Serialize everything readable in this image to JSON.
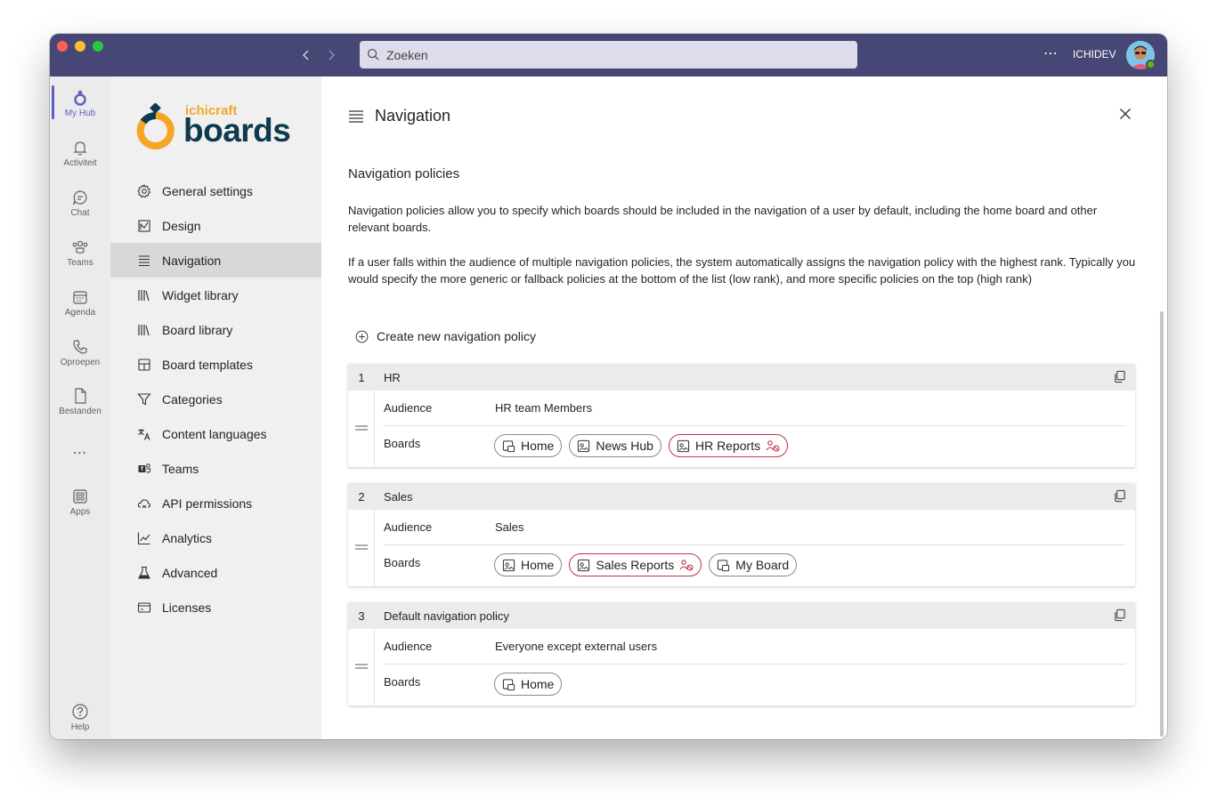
{
  "titlebar": {
    "search_placeholder": "Zoeken",
    "more": "⋯",
    "org": "ICHIDEV"
  },
  "rail": {
    "items": [
      {
        "label": "My Hub",
        "icon": "myhub-icon"
      },
      {
        "label": "Activiteit",
        "icon": "bell-icon"
      },
      {
        "label": "Chat",
        "icon": "chat-icon"
      },
      {
        "label": "Teams",
        "icon": "teams-icon"
      },
      {
        "label": "Agenda",
        "icon": "calendar-icon"
      },
      {
        "label": "Oproepen",
        "icon": "phone-icon"
      },
      {
        "label": "Bestanden",
        "icon": "file-icon"
      }
    ],
    "more": "⋯",
    "apps": "Apps",
    "help": "Help"
  },
  "logo": {
    "small": "ichicraft",
    "big": "boards"
  },
  "sidebar": {
    "items": [
      {
        "label": "General settings",
        "icon": "gear-icon"
      },
      {
        "label": "Design",
        "icon": "design-icon"
      },
      {
        "label": "Navigation",
        "icon": "list-icon"
      },
      {
        "label": "Widget library",
        "icon": "library-icon"
      },
      {
        "label": "Board library",
        "icon": "library-icon"
      },
      {
        "label": "Board templates",
        "icon": "template-icon"
      },
      {
        "label": "Categories",
        "icon": "filter-icon"
      },
      {
        "label": "Content languages",
        "icon": "translate-icon"
      },
      {
        "label": "Teams",
        "icon": "teams-icon"
      },
      {
        "label": "API permissions",
        "icon": "cloud-icon"
      },
      {
        "label": "Analytics",
        "icon": "chart-icon"
      },
      {
        "label": "Advanced",
        "icon": "flask-icon"
      },
      {
        "label": "Licenses",
        "icon": "card-icon"
      }
    ],
    "active_index": 2
  },
  "main": {
    "title": "Navigation",
    "section_title": "Navigation policies",
    "desc1": "Navigation policies allow you to specify which boards should be included in the navigation of a user by default, including the home board and other relevant boards.",
    "desc2": "If a user falls within the audience of multiple navigation policies, the system automatically assigns the navigation policy with the highest rank. Typically you would specify the more generic or fallback policies at the bottom of the list (low rank), and more specific policies on the top (high rank)",
    "create_label": "Create new navigation policy",
    "audience_label": "Audience",
    "boards_label": "Boards",
    "policies": [
      {
        "rank": "1",
        "name": "HR",
        "audience": "HR team Members",
        "boards": [
          {
            "label": "Home",
            "icon": "home-board-icon",
            "targeted": false
          },
          {
            "label": "News Hub",
            "icon": "board-icon",
            "targeted": false
          },
          {
            "label": "HR Reports",
            "icon": "board-icon",
            "targeted": true
          }
        ]
      },
      {
        "rank": "2",
        "name": "Sales",
        "audience": "Sales",
        "boards": [
          {
            "label": "Home",
            "icon": "board-icon",
            "targeted": false
          },
          {
            "label": "Sales Reports",
            "icon": "board-icon",
            "targeted": true
          },
          {
            "label": "My Board",
            "icon": "home-board-icon",
            "targeted": false
          }
        ]
      },
      {
        "rank": "3",
        "name": "Default navigation policy",
        "audience": "Everyone except external users",
        "boards": [
          {
            "label": "Home",
            "icon": "home-board-icon",
            "targeted": false
          }
        ]
      }
    ]
  },
  "colors": {
    "titlebar": "#464775",
    "accent": "#5b5fc7",
    "targeted_chip": "#c4314b",
    "logo_orange": "#f5a623",
    "logo_navy": "#0e3a4f"
  }
}
